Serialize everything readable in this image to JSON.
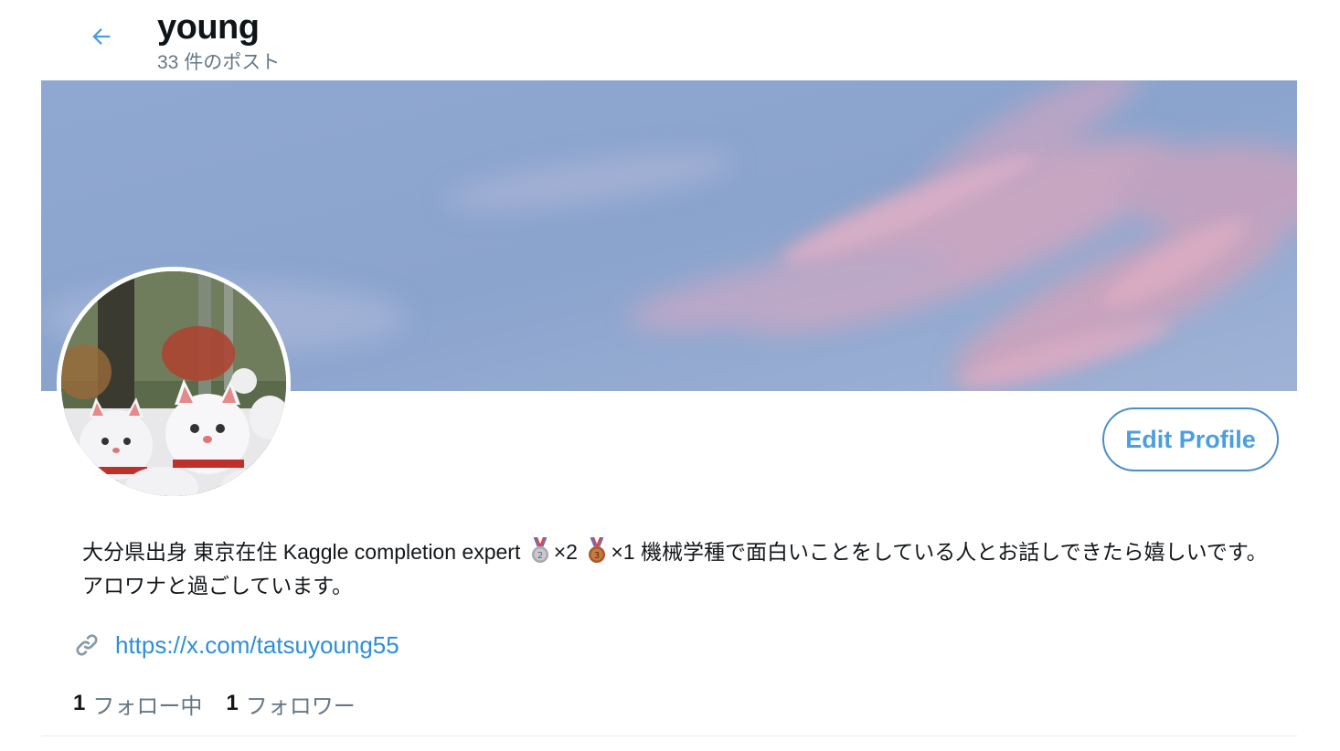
{
  "header": {
    "title": "young",
    "post_count": "33 件のポスト",
    "back_icon": "arrow-left-icon"
  },
  "profile": {
    "edit_button_label": "Edit Profile",
    "bio_part1": "大分県出身 東京在住 Kaggle completion expert ",
    "silver_count": "×2 ",
    "bronze_count": "×1 機械学種で面白いことをしている人とお話しできたら嬉しいです。 アロワナと過ごしています。",
    "link": "https://x.com/tatsuyoung55",
    "link_icon": "link-icon"
  },
  "stats": {
    "following_count": "1",
    "following_label": "フォロー中",
    "followers_count": "1",
    "followers_label": "フォロワー"
  },
  "colors": {
    "accent": "#4a9fe0",
    "link": "#2f8fd6",
    "muted": "#657786",
    "text": "#14171a"
  }
}
